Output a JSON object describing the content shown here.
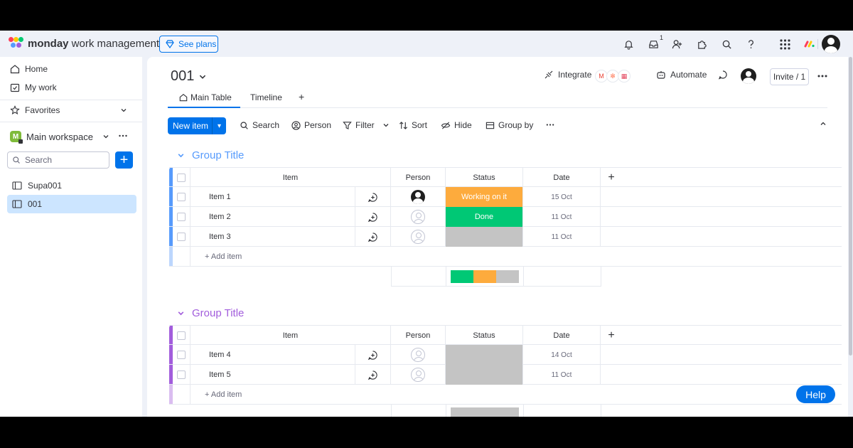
{
  "app": {
    "brand_bold": "monday",
    "brand_rest": " work management",
    "see_plans": "See plans",
    "inbox_count": "1"
  },
  "sidebar": {
    "home": "Home",
    "my_work": "My work",
    "favorites": "Favorites",
    "workspace": "Main workspace",
    "workspace_initial": "M",
    "search_placeholder": "Search",
    "boards": [
      {
        "label": "Supa001"
      },
      {
        "label": "001"
      }
    ]
  },
  "board": {
    "title": "001",
    "integrate": "Integrate",
    "automate": "Automate",
    "invite": "Invite / 1",
    "tabs": [
      {
        "label": "Main Table"
      },
      {
        "label": "Timeline"
      }
    ],
    "add_tab": "+"
  },
  "toolbar": {
    "new_item": "New item",
    "search": "Search",
    "person": "Person",
    "filter": "Filter",
    "sort": "Sort",
    "hide": "Hide",
    "group_by": "Group by"
  },
  "columns": {
    "item": "Item",
    "person": "Person",
    "status": "Status",
    "date": "Date",
    "add": "+"
  },
  "groups": [
    {
      "title": "Group Title",
      "color": "#579bfc",
      "add_item": "+ Add item",
      "rows": [
        {
          "name": "Item 1",
          "person": "assigned",
          "status": "Working on it",
          "status_color": "#fdab3d",
          "date": "15 Oct"
        },
        {
          "name": "Item 2",
          "person": "empty",
          "status": "Done",
          "status_color": "#00c875",
          "date": "11 Oct"
        },
        {
          "name": "Item 3",
          "person": "empty",
          "status": "",
          "status_color": "#c4c4c4",
          "date": "11 Oct"
        }
      ],
      "summary": [
        {
          "color": "#00c875",
          "fraction": 0.333
        },
        {
          "color": "#fdab3d",
          "fraction": 0.333
        },
        {
          "color": "#c4c4c4",
          "fraction": 0.334
        }
      ]
    },
    {
      "title": "Group Title",
      "color": "#a25ddc",
      "add_item": "+ Add item",
      "rows": [
        {
          "name": "Item 4",
          "person": "empty",
          "status": "",
          "status_color": "#c4c4c4",
          "date": "14 Oct"
        },
        {
          "name": "Item 5",
          "person": "empty",
          "status": "",
          "status_color": "#c4c4c4",
          "date": "11 Oct"
        }
      ],
      "summary": [
        {
          "color": "#c4c4c4",
          "fraction": 1.0
        }
      ]
    }
  ],
  "help": "Help"
}
